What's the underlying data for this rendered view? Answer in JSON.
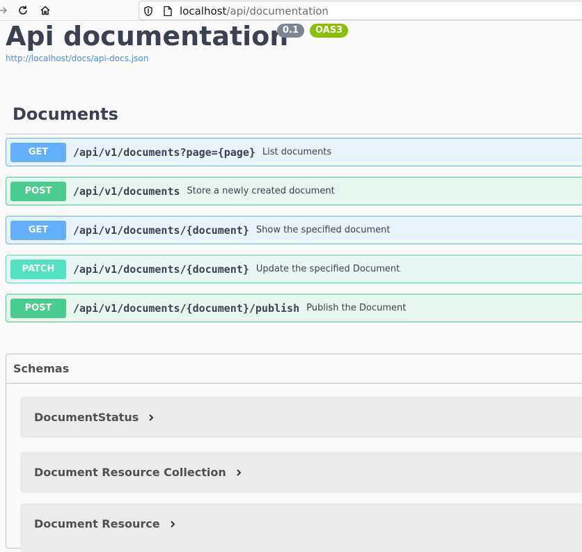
{
  "browser": {
    "url_host": "localhost",
    "url_path": "/api/documentation"
  },
  "info": {
    "title": "Api documentation",
    "version": "0.1",
    "oas_badge": "OAS3",
    "spec_url": "http://localhost/docs/api-docs.json"
  },
  "tag": {
    "name": "Documents",
    "operations": [
      {
        "method": "GET",
        "path": "/api/v1/documents?page={page}",
        "summary": "List documents"
      },
      {
        "method": "POST",
        "path": "/api/v1/documents",
        "summary": "Store a newly created document"
      },
      {
        "method": "GET",
        "path": "/api/v1/documents/{document}",
        "summary": "Show the specified document"
      },
      {
        "method": "PATCH",
        "path": "/api/v1/documents/{document}",
        "summary": "Update the specified Document"
      },
      {
        "method": "POST",
        "path": "/api/v1/documents/{document}/publish",
        "summary": "Publish the Document"
      }
    ]
  },
  "schemas": {
    "title": "Schemas",
    "models": [
      {
        "name": "DocumentStatus"
      },
      {
        "name": "Document Resource Collection"
      },
      {
        "name": "Document Resource"
      }
    ]
  },
  "colors": {
    "get": "#61affe",
    "post": "#49cc90",
    "patch": "#50e3c2",
    "version_badge": "#7d8492",
    "oas_badge": "#89bf04",
    "link": "#4990e2"
  }
}
